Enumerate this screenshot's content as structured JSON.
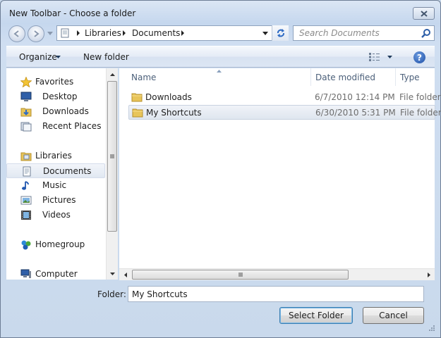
{
  "window": {
    "title": "New Toolbar - Choose a folder"
  },
  "address": {
    "crumbs": [
      "Libraries",
      "Documents"
    ]
  },
  "search": {
    "placeholder": "Search Documents"
  },
  "commandbar": {
    "organize": "Organize",
    "new_folder": "New folder",
    "help": "?"
  },
  "navpane": {
    "favorites": {
      "label": "Favorites",
      "items": [
        {
          "label": "Desktop",
          "icon": "desktop-icon"
        },
        {
          "label": "Downloads",
          "icon": "downloads-folder-icon"
        },
        {
          "label": "Recent Places",
          "icon": "recent-places-icon"
        }
      ]
    },
    "libraries": {
      "label": "Libraries",
      "items": [
        {
          "label": "Documents",
          "icon": "documents-icon",
          "selected": true
        },
        {
          "label": "Music",
          "icon": "music-icon"
        },
        {
          "label": "Pictures",
          "icon": "pictures-icon"
        },
        {
          "label": "Videos",
          "icon": "videos-icon"
        }
      ]
    },
    "homegroup": {
      "label": "Homegroup"
    },
    "computer": {
      "label": "Computer"
    }
  },
  "filelist": {
    "columns": {
      "name": "Name",
      "date": "Date modified",
      "type": "Type"
    },
    "rows": [
      {
        "name": "Downloads",
        "date": "6/7/2010 12:14 PM",
        "type": "File folder",
        "selected": false
      },
      {
        "name": "My Shortcuts",
        "date": "6/30/2010 5:31 PM",
        "type": "File folder",
        "selected": true
      }
    ]
  },
  "footer": {
    "folder_label": "Folder:",
    "folder_value": "My Shortcuts",
    "select_button": "Select Folder",
    "cancel_button": "Cancel"
  },
  "colors": {
    "accent": "#3c7fb1",
    "folder": "#e8c55a",
    "window_frame": "#c9d9ec"
  }
}
